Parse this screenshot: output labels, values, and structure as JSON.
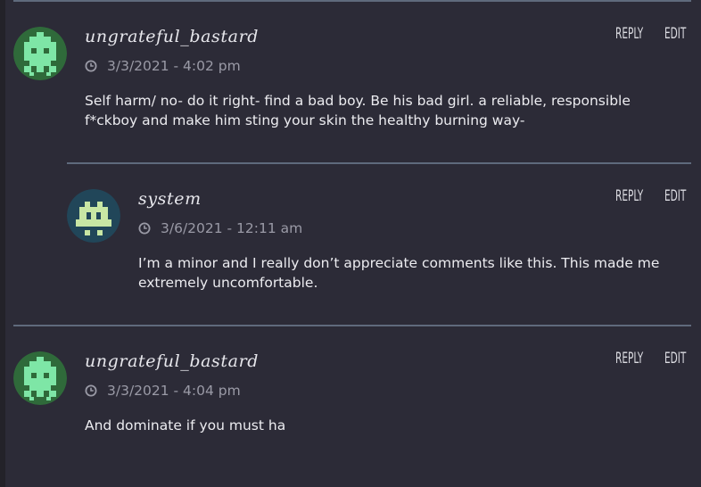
{
  "comments": [
    {
      "author": "ungrateful_bastard",
      "timestamp": "3/3/2021 - 4:02 pm",
      "body": "Self harm/ no- do it right- find a bad boy. Be his bad girl. a reliable, responsible f*ckboy and make him sting your skin the healthy burning way-",
      "reply_label": "REPLY",
      "edit_label": "EDIT",
      "avatar_icon": "space-invader-icon",
      "avatar_bg": "#2f6a3a",
      "avatar_fg": "#7ee6a6"
    },
    {
      "author": "system",
      "timestamp": "3/6/2021 - 12:11 am",
      "body": "I’m a minor and I really don’t appreciate comments like this. This made me extremely uncomfortable.",
      "reply_label": "REPLY",
      "edit_label": "EDIT",
      "avatar_icon": "robot-invader-icon",
      "avatar_bg": "#214659",
      "avatar_fg": "#c8e6a4"
    },
    {
      "author": "ungrateful_bastard",
      "timestamp": "3/3/2021 - 4:04 pm",
      "body": "And dominate if you must ha",
      "reply_label": "REPLY",
      "edit_label": "EDIT",
      "avatar_icon": "space-invader-icon",
      "avatar_bg": "#2f6a3a",
      "avatar_fg": "#7ee6a6"
    }
  ],
  "colors": {
    "background": "#2c2b37",
    "divider": "#5f6a7c",
    "text": "#ececf0",
    "muted": "#9a9aa6"
  }
}
